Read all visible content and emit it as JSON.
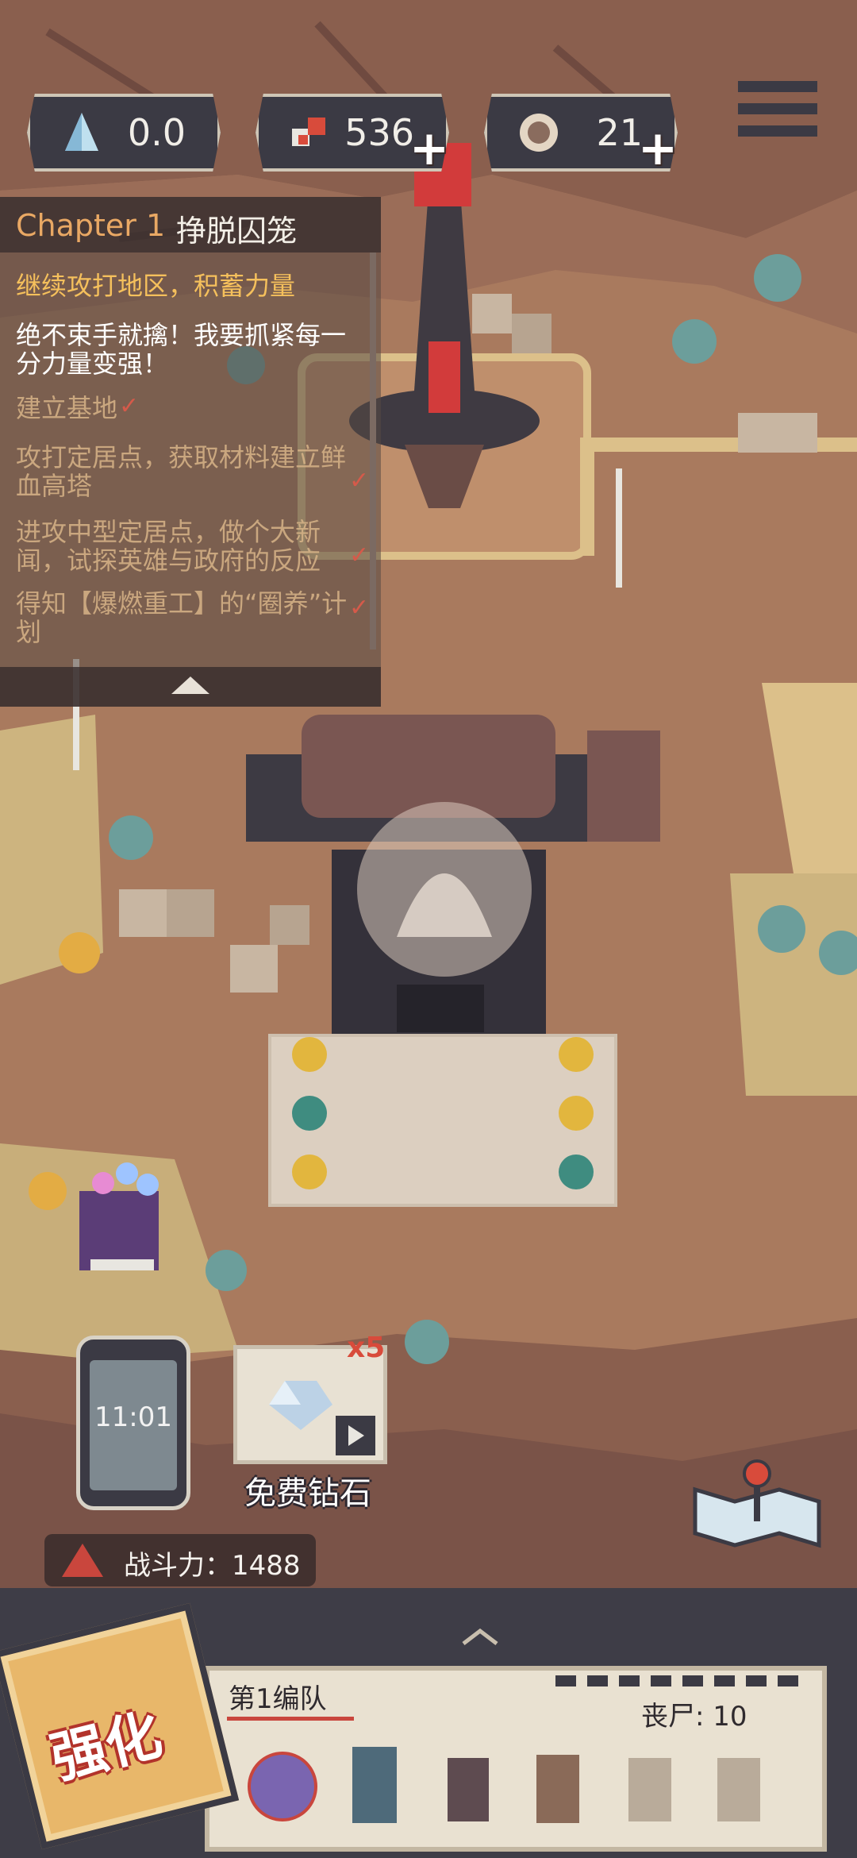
{
  "resources": {
    "energy": {
      "value": "0.0",
      "icon": "crystal-icon"
    },
    "material": {
      "value": "536",
      "icon": "ore-icon"
    },
    "coin": {
      "value": "21",
      "icon": "coin-icon"
    }
  },
  "quest_panel": {
    "chapter": "Chapter 1",
    "chapter_title": "挣脱囚笼",
    "current_goal": "继续攻打地区，积蓄力量",
    "description": "绝不束手就擒！我要抓紧每一分力量变强！",
    "tasks": [
      {
        "label": "建立基地",
        "done": true
      },
      {
        "label": "攻打定居点，获取材料建立鲜血高塔",
        "done": true
      },
      {
        "label": "进攻中型定居点，做个大新闻，试探英雄与政府的反应",
        "done": true
      },
      {
        "label": "得知【爆燃重工】的“圈养”计划",
        "done": true
      }
    ]
  },
  "phone": {
    "time": "11:01"
  },
  "free_gems": {
    "label": "免费钻石",
    "multiplier": "x5"
  },
  "combat_power": {
    "label": "战斗力：1488"
  },
  "squad": {
    "name": "第1编队",
    "zombie_label": "丧尸: 10"
  },
  "upgrade_button": {
    "label": "强化"
  },
  "colors": {
    "accent_red": "#d84b3b",
    "panel_dark": "#3b3a44",
    "ground": "#a97a5e",
    "sand": "#dcc08a"
  }
}
